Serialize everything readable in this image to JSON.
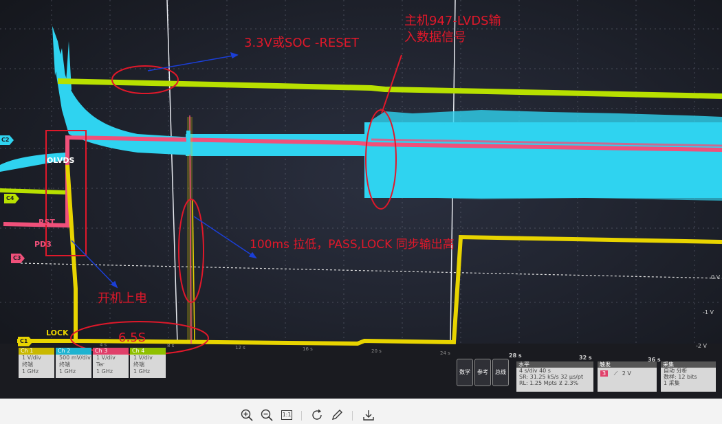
{
  "photo": {
    "annotations": {
      "soc_reset": "3.3V或SOC -RESET",
      "lvds_line1": "主机947-LVDS输",
      "lvds_line2": "入数据信号",
      "pass_lock": "100ms 拉低，PASS,LOCK 同步输出高",
      "power_on": "开机上电",
      "duration": "6.5S"
    },
    "trace_labels": {
      "olvds": "OLVDS",
      "rst": "RST",
      "pd3": "PD3",
      "lock": "LOCK"
    },
    "channel_markers": [
      "C2",
      "C4",
      "C3",
      "C1"
    ],
    "voltage_labels": [
      "0 V",
      "-1 V",
      "-2 V"
    ],
    "time_labels": [
      "4 s",
      "8 s",
      "12 s",
      "16 s",
      "20 s",
      "24 s",
      "28 s",
      "32 s",
      "36 s"
    ],
    "channels": [
      {
        "name": "Ch 1",
        "l1": "1 V/div",
        "l2": "终端",
        "l3": "1 GHz"
      },
      {
        "name": "Ch 2",
        "l1": "500 mV/div",
        "l2": "终端",
        "l3": "1 GHz"
      },
      {
        "name": "Ch 3",
        "l1": "1 V/div",
        "l2": "Ter",
        "l3": "1 GHz"
      },
      {
        "name": "Ch 4",
        "l1": "1 V/div",
        "l2": "终端",
        "l3": "1 GHz"
      }
    ],
    "buttons": {
      "math": "数学",
      "ref": "参考",
      "bus": "总线"
    },
    "horizontal": {
      "title": "水平",
      "l1": "4 s/div        40 s",
      "l2": "SR: 31.25 kS/s   32 μs/pt",
      "l3": "RL: 1.25 Mpts   ⊻ 2.3%"
    },
    "trigger": {
      "title": "触发",
      "value": "2 V"
    },
    "acquire": {
      "title": "采集",
      "l1": "自动        分析",
      "l2": "数样: 12 bits",
      "l3": "1 采集"
    },
    "colors": {
      "ch1": "#e8d400",
      "ch2": "#2fd3f0",
      "ch3": "#f0507a",
      "ch4": "#b8e000",
      "annotation": "#e0182a",
      "arrow": "#1b3fd8"
    }
  },
  "toolbar": {
    "icons": [
      "zoom-in-icon",
      "zoom-out-icon",
      "actual-size-icon",
      "rotate-icon",
      "edit-icon",
      "download-icon"
    ],
    "actual_size": "1:1"
  }
}
